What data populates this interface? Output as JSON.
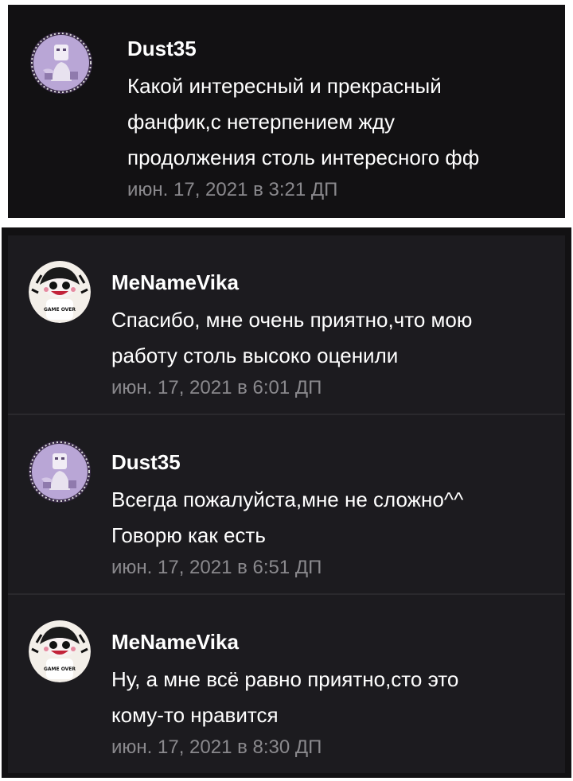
{
  "top_comment": {
    "username": "Dust35",
    "avatar_icon": "anime-girl-avatar-icon",
    "text": "Какой интересный и прекрасный\nфанфик,с нетерпением жду\nпродолжения столь интересного фф",
    "time": "июн. 17, 2021 в 3:21 ДП"
  },
  "replies": [
    {
      "username": "MeNameVika",
      "avatar_icon": "game-over-character-avatar-icon",
      "text": "Спасибо, мне очень приятно,что мою\nработу столь высоко оценили",
      "time": "июн. 17, 2021 в 6:01 ДП"
    },
    {
      "username": "Dust35",
      "avatar_icon": "anime-girl-avatar-icon",
      "text": "Всегда пожалуйста,мне не сложно^^\nГоворю как есть",
      "time": "июн. 17, 2021 в 6:51 ДП"
    },
    {
      "username": "MeNameVika",
      "avatar_icon": "game-over-character-avatar-icon",
      "text": "Ну, а мне всё равно приятно,сто это\nкому-то нравится",
      "time": "июн. 17, 2021 в 8:30 ДП"
    }
  ],
  "avatar_badge_text": "GAME OVER",
  "colors": {
    "background": "#121113",
    "card": "#1c1b1f",
    "username": "#ffffff",
    "text": "#ffffff",
    "timestamp": "#8a898d"
  }
}
